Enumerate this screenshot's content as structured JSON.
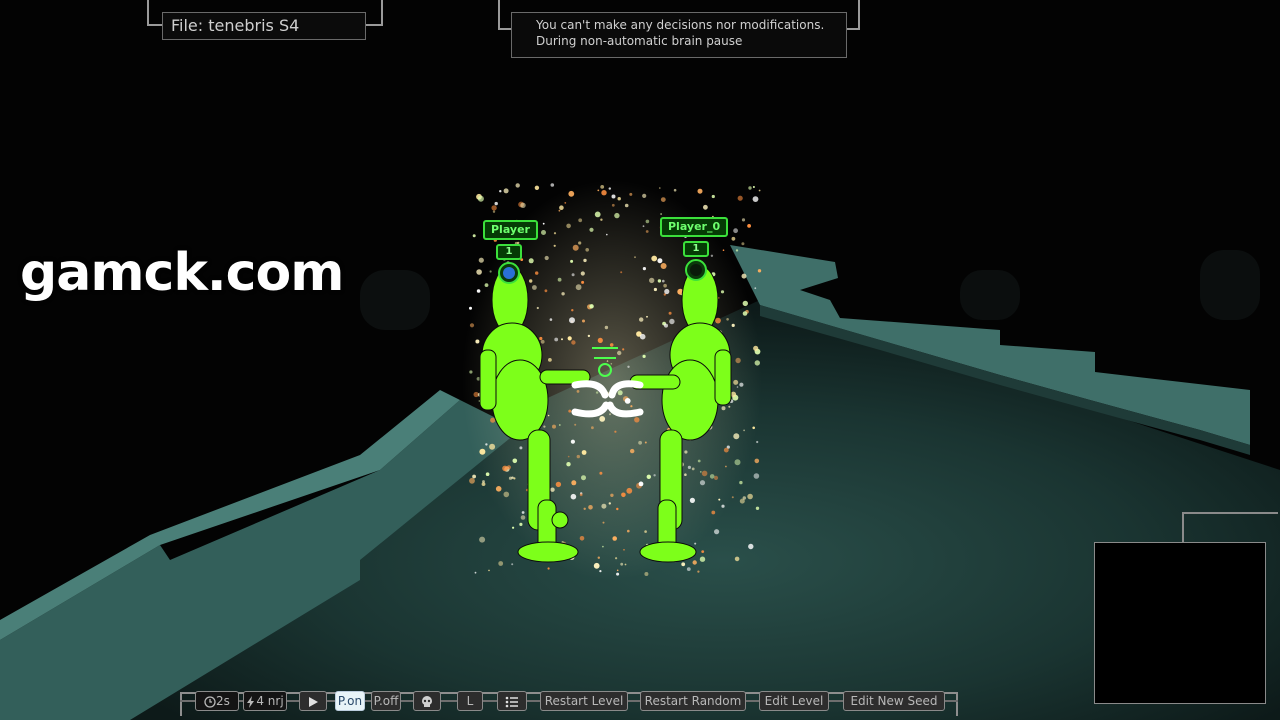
{
  "hud": {
    "file_label": "File: tenebris S4",
    "notice_line1": "You can't make any decisions nor modifications.",
    "notice_line2": "During non-automatic brain pause"
  },
  "watermark": "gamck.com",
  "players": [
    {
      "name": "Player",
      "level": "1",
      "marker_color": "#2a6fd6"
    },
    {
      "name": "Player_0",
      "level": "1",
      "marker_color": "#0a2a0a"
    }
  ],
  "colors": {
    "fighter": "#7dff1a",
    "floor": "#1c3c38",
    "ledge": "#3b6e68",
    "hud_border": "#8a8a8a",
    "tag_green": "#3be03b"
  },
  "toolbar": {
    "time": "2s",
    "energy": "4 nrj",
    "play_icon": "play-icon",
    "p_on": "P.on",
    "p_off": "P.off",
    "skull_icon": "skull-icon",
    "l_label": "L",
    "list_icon": "list-icon",
    "restart_level": "Restart Level",
    "restart_random": "Restart Random",
    "edit_level": "Edit Level",
    "edit_new_seed": "Edit New Seed"
  }
}
